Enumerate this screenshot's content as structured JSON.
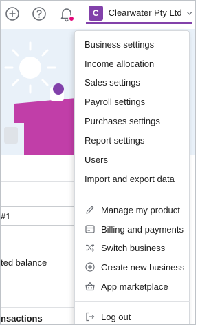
{
  "topbar": {
    "business_initial": "C",
    "business_name": "Clearwater Pty Ltd"
  },
  "background": {
    "field_value": "#1",
    "balance_text": "ted balance",
    "transactions_text": "nsactions"
  },
  "menu": {
    "settings_items": [
      "Business settings",
      "Income allocation",
      "Sales settings",
      "Payroll settings",
      "Purchases settings",
      "Report settings",
      "Users",
      "Import and export data"
    ],
    "actions": [
      {
        "label": "Manage my product",
        "icon": "pencil-icon"
      },
      {
        "label": "Billing and payments",
        "icon": "billing-icon"
      },
      {
        "label": "Switch business",
        "icon": "shuffle-icon"
      },
      {
        "label": "Create new business",
        "icon": "add-circle-icon"
      },
      {
        "label": "App marketplace",
        "icon": "basket-icon"
      }
    ],
    "logout": {
      "label": "Log out",
      "icon": "logout-icon"
    }
  },
  "colors": {
    "brand": "#8241aa",
    "notification": "#e3097a",
    "hero_bg": "#e9f1f9"
  }
}
